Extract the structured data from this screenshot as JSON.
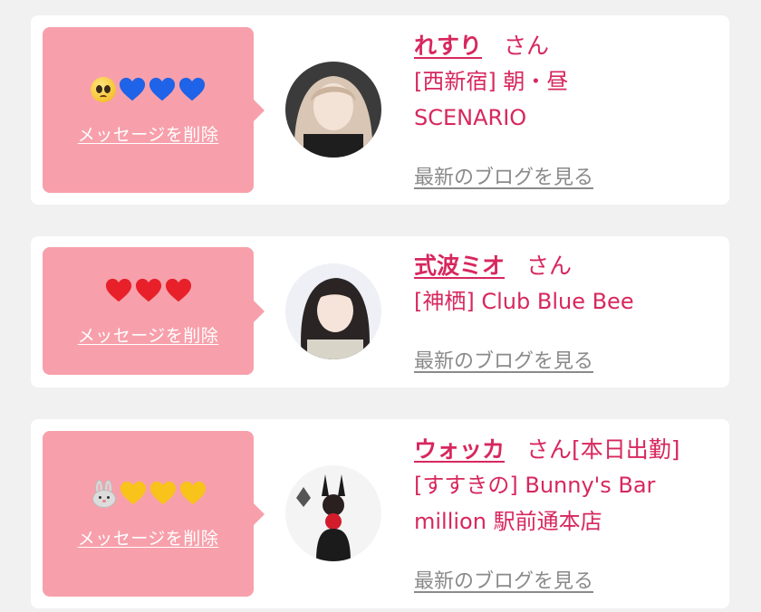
{
  "colors": {
    "accent": "#d7275e",
    "bubble": "#f7a0ab",
    "link_gray": "#8a8a8a"
  },
  "entries": [
    {
      "emoji": [
        "pleading-face",
        "blue-heart",
        "blue-heart",
        "blue-heart"
      ],
      "delete_label": "メッセージを削除",
      "name": "れすり",
      "honorific": "さん",
      "shop_lines": [
        "[西新宿] 朝・昼",
        "SCENARIO"
      ],
      "blog_label": "最新のブログを見る"
    },
    {
      "emoji": [
        "red-heart",
        "red-heart",
        "red-heart"
      ],
      "delete_label": "メッセージを削除",
      "name": "式波ミオ",
      "honorific": "さん",
      "shop_lines": [
        "[神栖] Club Blue Bee"
      ],
      "blog_label": "最新のブログを見る"
    },
    {
      "emoji": [
        "rabbit-face",
        "yellow-heart",
        "yellow-heart",
        "yellow-heart"
      ],
      "delete_label": "メッセージを削除",
      "name": "ウォッカ",
      "honorific": "さん[本日出勤]",
      "shop_lines": [
        "[すすきの] Bunny's Bar",
        "million 駅前通本店"
      ],
      "blog_label": "最新のブログを見る"
    }
  ]
}
